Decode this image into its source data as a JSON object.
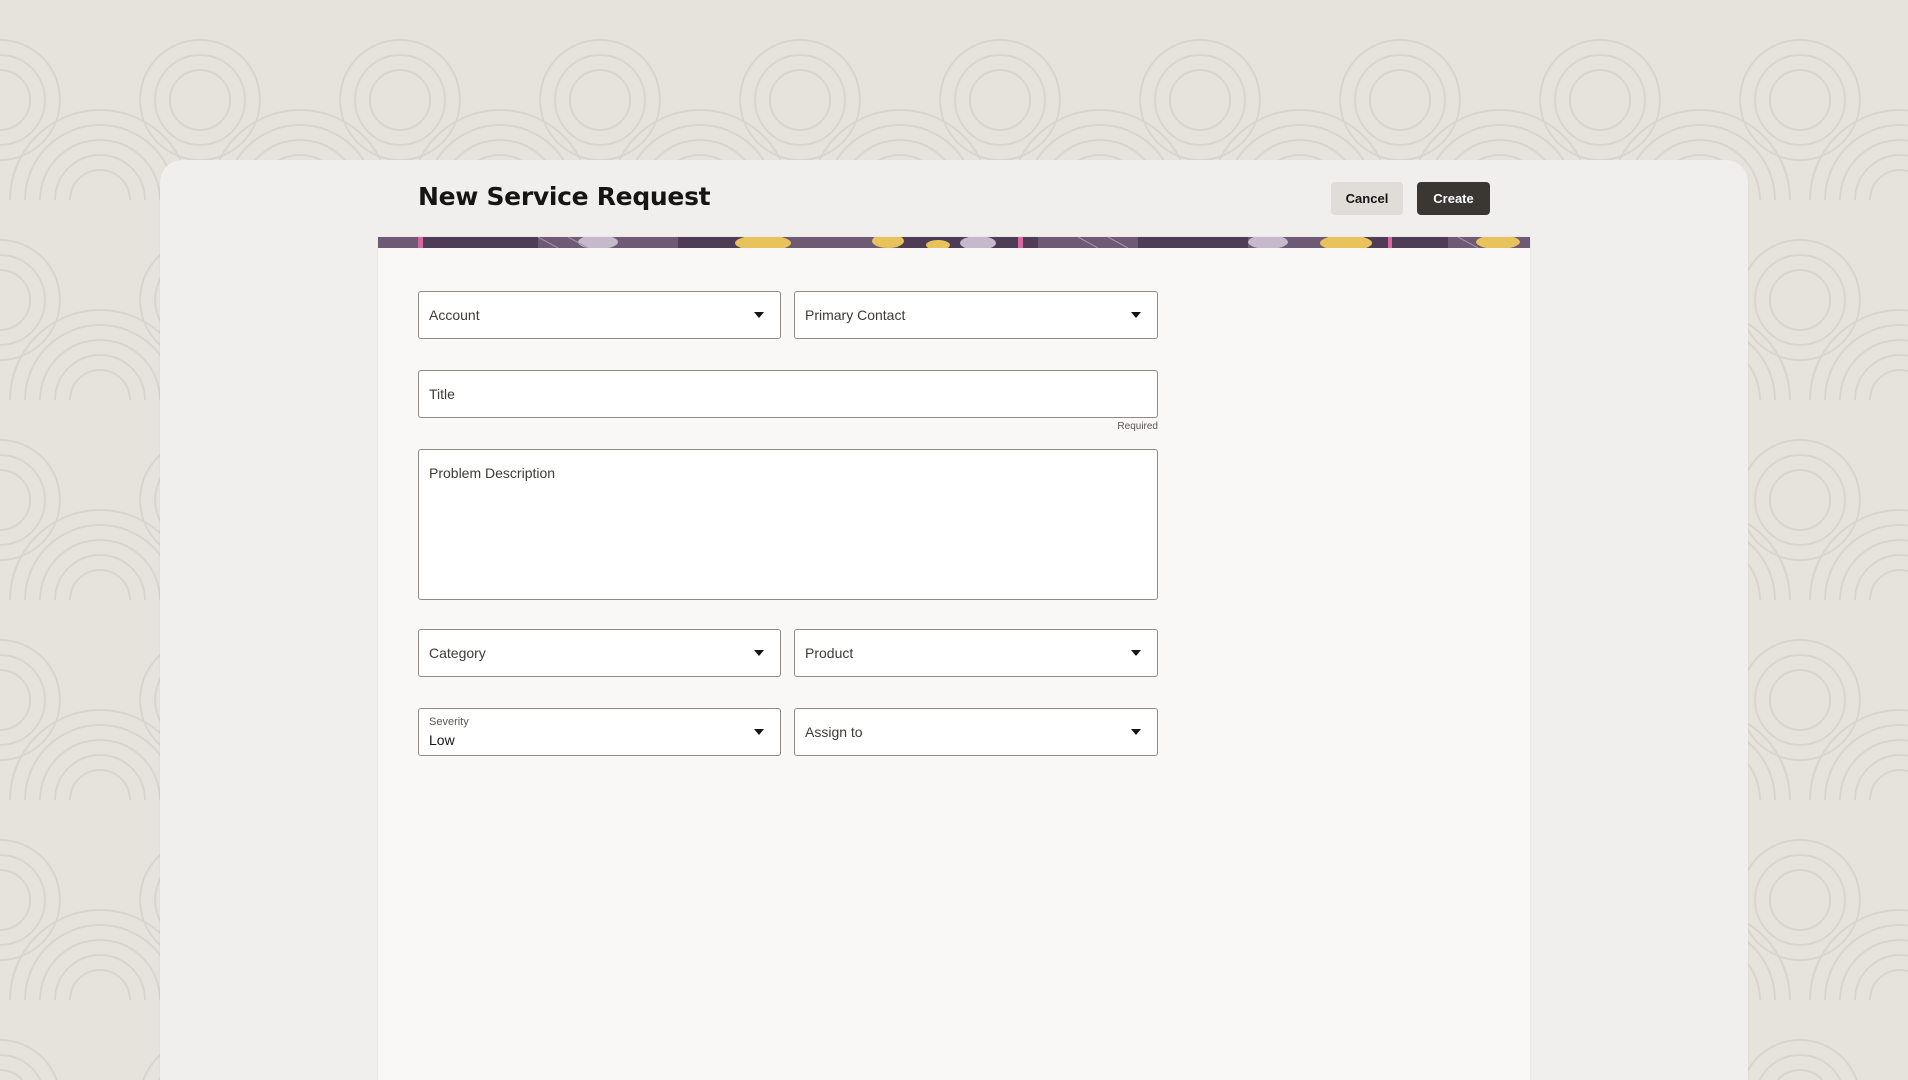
{
  "page": {
    "title": "New Service Request"
  },
  "toolbar": {
    "cancel_label": "Cancel",
    "create_label": "Create"
  },
  "form": {
    "account": {
      "label": "Account"
    },
    "primary_contact": {
      "label": "Primary Contact"
    },
    "title": {
      "label": "Title",
      "helper": "Required"
    },
    "problem_description": {
      "label": "Problem Description"
    },
    "category": {
      "label": "Category"
    },
    "product": {
      "label": "Product"
    },
    "severity": {
      "label": "Severity",
      "value": "Low"
    },
    "assign_to": {
      "label": "Assign to"
    }
  },
  "icons": {
    "dropdown": "chevron-down-icon"
  },
  "colors": {
    "background": "#e6e3dd",
    "panel": "#f1efed",
    "card": "#f9f8f6",
    "primary_button": "#3a3632",
    "secondary_button": "#e0ddd8",
    "banner_purple": "#6f5a75",
    "banner_yellow": "#e8c35c",
    "banner_pink": "#d7689f"
  }
}
